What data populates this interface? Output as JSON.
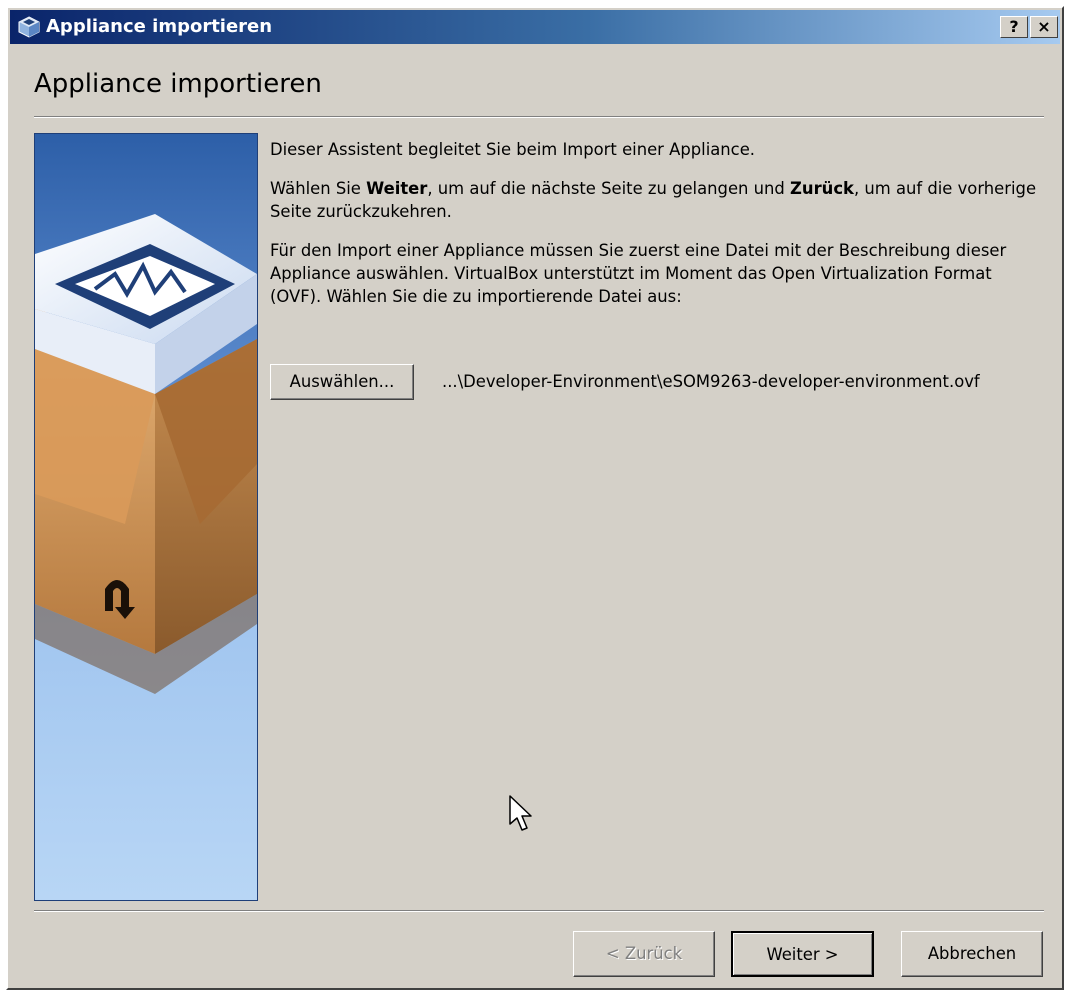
{
  "window": {
    "title": "Appliance importieren",
    "help_label": "?",
    "close_label": "×"
  },
  "page": {
    "heading": "Appliance importieren",
    "intro": "Dieser Assistent begleitet Sie beim Import einer Appliance.",
    "nav_hint": {
      "part1": "Wählen Sie ",
      "weiter": "Weiter",
      "part2": ", um auf die nächste Seite zu gelangen und ",
      "zurueck": "Zurück",
      "part3": ", um auf die vorherige Seite zurückzukehren."
    },
    "import_text": "Für den Import einer Appliance müssen Sie zuerst eine Datei mit der Beschreibung dieser Appliance auswählen. VirtualBox unterstützt im Moment das Open Virtualization Format (OVF). Wählen Sie die zu importierende Datei aus:",
    "choose_button": "Auswählen...",
    "file_path": "...\\Developer-Environment\\eSOM9263-developer-environment.ovf"
  },
  "buttons": {
    "back": "< Zurück",
    "back_enabled": false,
    "next": "Weiter >",
    "cancel": "Abbrechen"
  },
  "icons": {
    "title_icon": "virtualbox-icon",
    "side_image": "virtualbox-appliance-box-icon",
    "cursor": "mouse-cursor-icon"
  },
  "colors": {
    "titlebar_start": "#0a246a",
    "titlebar_end": "#a6caf0",
    "dialog_background": "#d4d0c8",
    "side_panel_top": "#2d5fa8",
    "side_panel_bottom": "#b8d6f5"
  }
}
